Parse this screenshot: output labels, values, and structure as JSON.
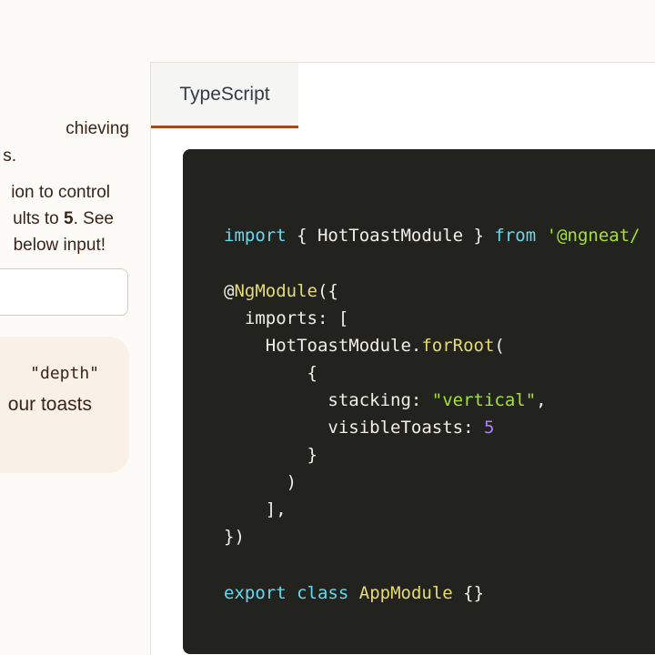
{
  "left": {
    "desc_lines": [
      "chieving",
      "s.",
      "ion to control",
      "ults to ",
      "5",
      ". See",
      " below input!"
    ],
    "input_value": "",
    "card_code": "\"depth\"",
    "card_text": "our toasts"
  },
  "tabs": [
    {
      "label": "TypeScript",
      "active": true
    }
  ],
  "code": {
    "line1": {
      "kw1": "import",
      "p1": " { HotToastModule } ",
      "kw2": "from",
      "p2": " ",
      "s1": "'@ngneat/"
    },
    "line3": {
      "d1": "@",
      "f1": "NgModule",
      "p1": "({"
    },
    "line4": {
      "p1": "  imports: ["
    },
    "line5": {
      "p1": "    HotToastModule.",
      "f1": "forRoot",
      "p2": "("
    },
    "line6": {
      "p1": "        {"
    },
    "line7": {
      "p1": "          stacking: ",
      "s1": "\"vertical\"",
      "p2": ","
    },
    "line8": {
      "p1": "          visibleToasts: ",
      "n1": "5"
    },
    "line9": {
      "p1": "        }"
    },
    "line10": {
      "p1": "      )"
    },
    "line11": {
      "p1": "    ],"
    },
    "line12": {
      "p1": "})"
    },
    "line14": {
      "kw1": "export",
      "p1": " ",
      "kw2": "class",
      "p2": " ",
      "f1": "AppModule",
      "p3": " {}"
    }
  }
}
